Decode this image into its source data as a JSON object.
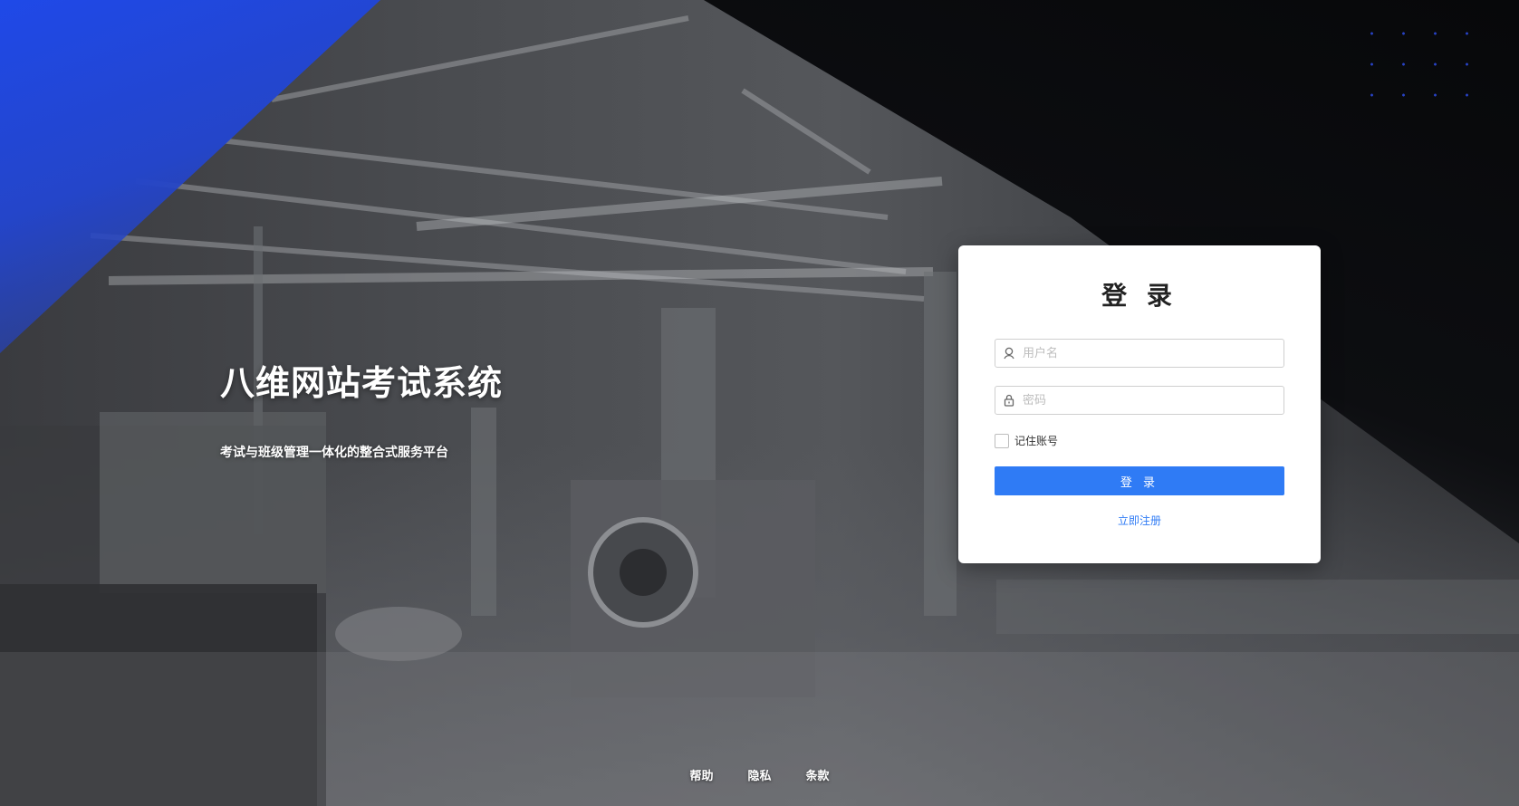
{
  "hero": {
    "title": "八维网站考试系统",
    "subtitle": "考试与班级管理一体化的整合式服务平台"
  },
  "login": {
    "title": "登 录",
    "username_placeholder": "用户名",
    "password_placeholder": "密码",
    "remember_label": "记住账号",
    "submit_label": "登 录",
    "register_label": "立即注册"
  },
  "footer": {
    "links": [
      "帮助",
      "隐私",
      "条款"
    ]
  },
  "colors": {
    "accent": "#2f7bf5",
    "brand_blue": "#1f49e8"
  },
  "icons": {
    "username": "user-icon",
    "password": "lock-icon"
  }
}
